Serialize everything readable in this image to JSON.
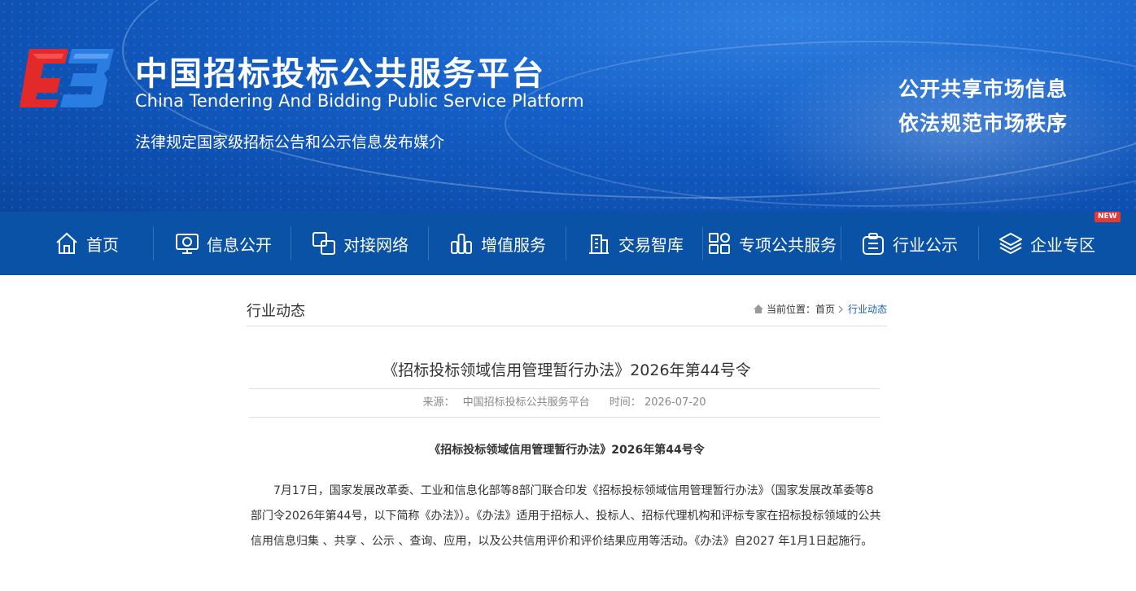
{
  "header": {
    "title_cn": "中国招标投标公共服务平台",
    "title_en": "China Tendering And Bidding Public Service Platform",
    "subtitle": "法律规定国家级招标公告和公示信息发布媒介",
    "slogan_line1": "公开共享市场信息",
    "slogan_line2": "依法规范市场秩序",
    "logo": "cebpub-logo"
  },
  "nav": {
    "items": [
      {
        "label": "首页",
        "icon": "home-icon"
      },
      {
        "label": "信息公开",
        "icon": "monitor-icon"
      },
      {
        "label": "对接网络",
        "icon": "network-icon"
      },
      {
        "label": "增值服务",
        "icon": "bar-chart-icon"
      },
      {
        "label": "交易智库",
        "icon": "building-icon"
      },
      {
        "label": "专项公共服务",
        "icon": "grid-icon"
      },
      {
        "label": "行业公示",
        "icon": "clipboard-icon"
      },
      {
        "label": "企业专区",
        "icon": "layers-icon"
      }
    ],
    "new_badge": "NEW"
  },
  "section": {
    "title": "行业动态",
    "breadcrumb_label": "当前位置：",
    "breadcrumb_home": "首页",
    "breadcrumb_current": "行业动态"
  },
  "article": {
    "title": "《招标投标领域信用管理暂行办法》2026年第44号令",
    "source_label": "来源：",
    "source": "中国招标投标公共服务平台",
    "time_label": "时间：",
    "time": "2026-07-20",
    "subtitle": "《招标投标领域信用管理暂行办法》2026年第44号令",
    "body": "7月17日，国家发展改革委、工业和信息化部等8部门联合印发《招标投标领域信用管理暂行办法》（国家发展改革委等8部门令2026年第44号，以下简称《办法》）。《办法》适用于招标人、投标人、招标代理机构和评标专家在招标投标领域的公共信用信息归集 、共享 、公示 、查询、应用，以及公共信用评价和评价结果应用等活动。《办法》自2027 年1月1日起施行。"
  },
  "colors": {
    "header_blue": "#1560c8",
    "nav_blue": "#0a52a6",
    "link_blue": "#1a5fb4",
    "logo_red": "#e32a2a"
  }
}
